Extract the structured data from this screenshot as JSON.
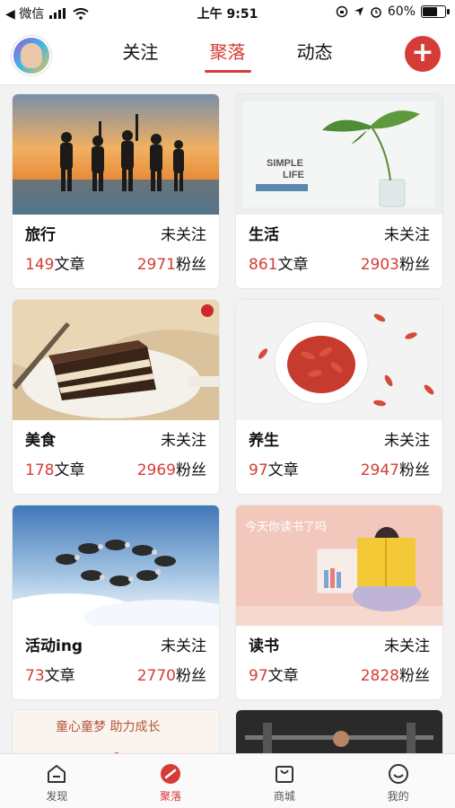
{
  "status_bar": {
    "back_label": "◀ 微信",
    "time": "上午 9:51",
    "battery": "60%"
  },
  "header": {
    "tabs": [
      "关注",
      "聚落",
      "动态"
    ],
    "active_tab": "聚落"
  },
  "cards": [
    {
      "name": "旅行",
      "follow": "未关注",
      "articles": "149",
      "articles_suffix": "文章",
      "fans": "2971",
      "fans_suffix": "粉丝"
    },
    {
      "name": "生活",
      "follow": "未关注",
      "articles": "861",
      "articles_suffix": "文章",
      "fans": "2903",
      "fans_suffix": "粉丝",
      "image_text_1": "SIMPLE",
      "image_text_2": "LIFE"
    },
    {
      "name": "美食",
      "follow": "未关注",
      "articles": "178",
      "articles_suffix": "文章",
      "fans": "2969",
      "fans_suffix": "粉丝"
    },
    {
      "name": "养生",
      "follow": "未关注",
      "articles": "97",
      "articles_suffix": "文章",
      "fans": "2947",
      "fans_suffix": "粉丝"
    },
    {
      "name": "活动ing",
      "follow": "未关注",
      "articles": "73",
      "articles_suffix": "文章",
      "fans": "2770",
      "fans_suffix": "粉丝"
    },
    {
      "name": "读书",
      "follow": "未关注",
      "articles": "97",
      "articles_suffix": "文章",
      "fans": "2828",
      "fans_suffix": "粉丝",
      "image_text": "今天你读书了吗"
    }
  ],
  "partial_cards": [
    {
      "image_text": "童心童梦 助力成长"
    },
    {
      "image_text": ""
    }
  ],
  "tabbar": {
    "items": [
      "发现",
      "聚落",
      "商城",
      "我的"
    ],
    "active": "聚落"
  },
  "colors": {
    "accent": "#d63c37"
  }
}
